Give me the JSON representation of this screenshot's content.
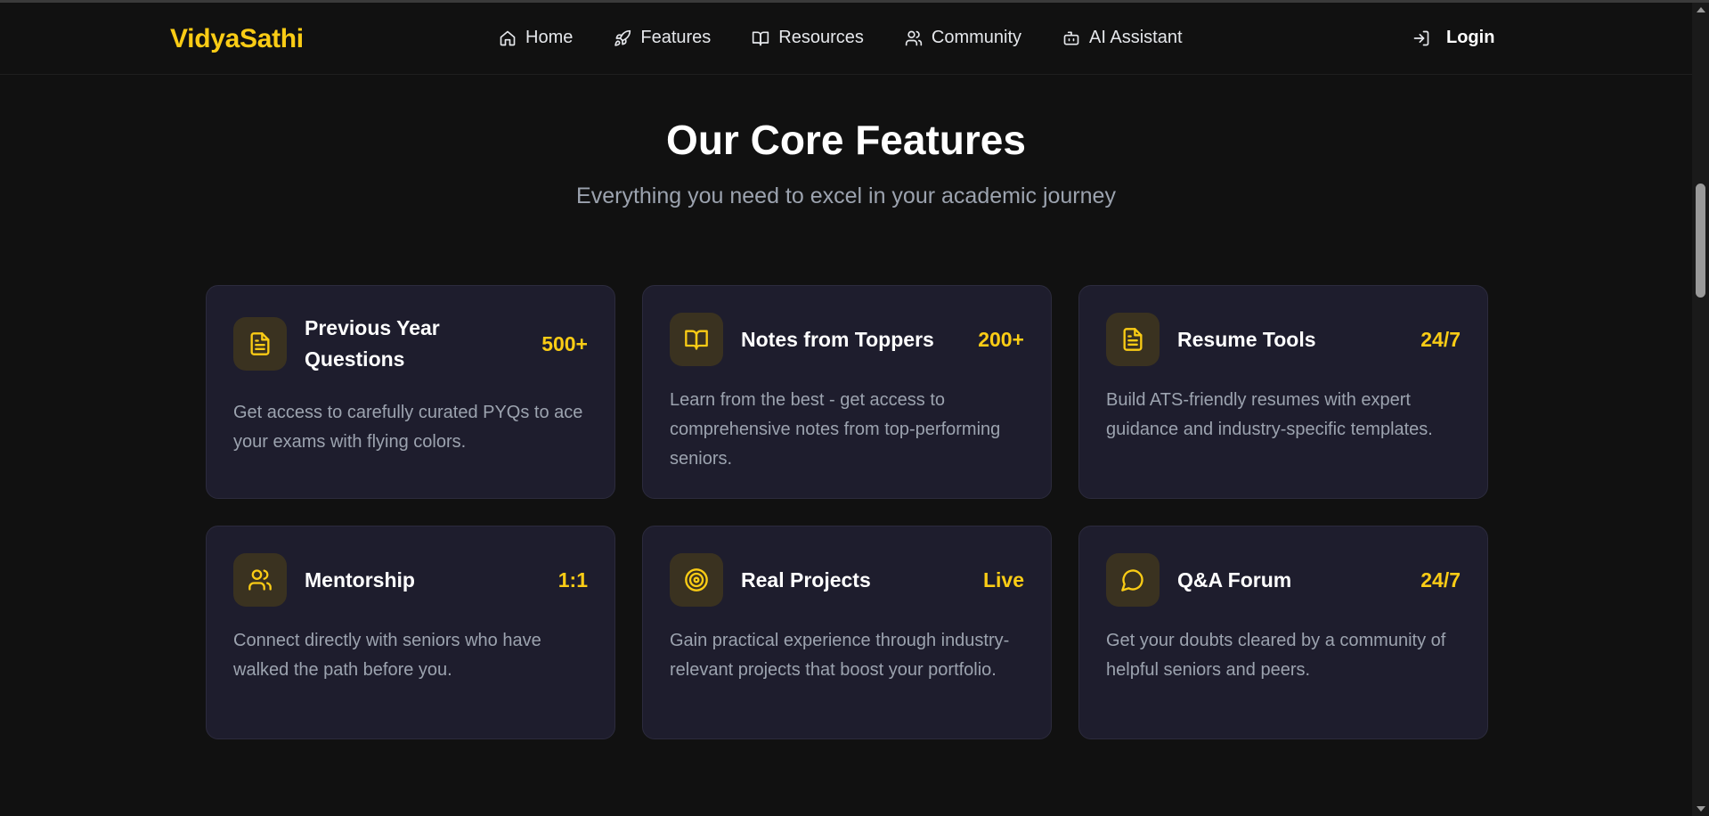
{
  "brand": "VidyaSathi",
  "nav": [
    {
      "label": "Home",
      "icon": "home-icon"
    },
    {
      "label": "Features",
      "icon": "rocket-icon"
    },
    {
      "label": "Resources",
      "icon": "book-icon"
    },
    {
      "label": "Community",
      "icon": "users-icon"
    },
    {
      "label": "AI Assistant",
      "icon": "bot-icon"
    }
  ],
  "login": {
    "label": "Login",
    "icon": "login-icon"
  },
  "hero": {
    "title": "Our Core Features",
    "subtitle": "Everything you need to excel in your academic journey"
  },
  "colors": {
    "accent": "#facc15",
    "background": "#111111",
    "card": "#1e1d2d",
    "icon_bg": "#3a3220",
    "muted_text": "#9ca3af"
  },
  "features": [
    {
      "title": "Previous Year Questions",
      "stat": "500+",
      "icon": "file-text-icon",
      "description": "Get access to carefully curated PYQs to ace your exams with flying colors."
    },
    {
      "title": "Notes from Toppers",
      "stat": "200+",
      "icon": "book-open-icon",
      "description": "Learn from the best - get access to comprehensive notes from top-performing seniors."
    },
    {
      "title": "Resume Tools",
      "stat": "24/7",
      "icon": "file-text-icon",
      "description": "Build ATS-friendly resumes with expert guidance and industry-specific templates."
    },
    {
      "title": "Mentorship",
      "stat": "1:1",
      "icon": "users-icon",
      "description": "Connect directly with seniors who have walked the path before you."
    },
    {
      "title": "Real Projects",
      "stat": "Live",
      "icon": "target-icon",
      "description": "Gain practical experience through industry-relevant projects that boost your portfolio."
    },
    {
      "title": "Q&A Forum",
      "stat": "24/7",
      "icon": "message-circle-icon",
      "description": "Get your doubts cleared by a community of helpful seniors and peers."
    }
  ]
}
